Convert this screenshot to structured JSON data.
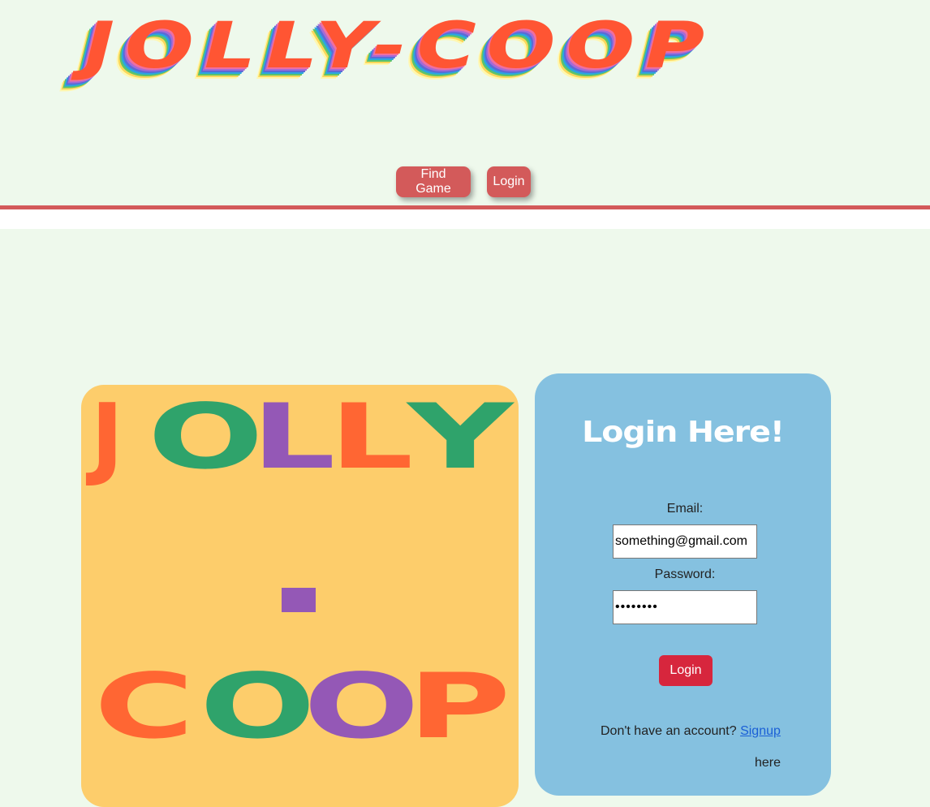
{
  "header": {
    "logo_text": "JOLLY-COOP",
    "logo_layers": [
      "#fbd85a",
      "#5cc36a",
      "#2aa6e0",
      "#5b6bd6",
      "#a66ad6",
      "#ef6fa0",
      "#ff5533"
    ]
  },
  "nav": {
    "find_game_label": "Find Game",
    "login_label": "Login",
    "accent_color": "#d35a5a"
  },
  "brand": {
    "word1": [
      "J",
      "O",
      "L",
      "L",
      "Y"
    ],
    "dash": "-",
    "word2": [
      "C",
      "O",
      "O",
      "P"
    ],
    "colors": {
      "orange": "#ff6633",
      "green": "#2fa36b",
      "purple": "#9458b6"
    }
  },
  "login_form": {
    "title": "Login Here!",
    "email_label": "Email:",
    "email_value": "something@gmail.com",
    "password_label": "Password:",
    "password_value": "••••••••",
    "submit_label": "Login",
    "signup_prompt": "Don't have an account?",
    "signup_link": "Signup",
    "signup_suffix": "here"
  }
}
